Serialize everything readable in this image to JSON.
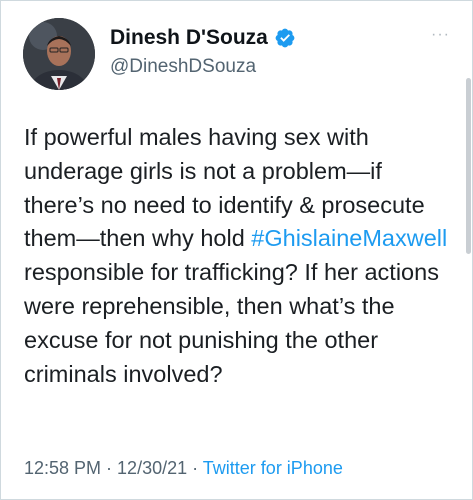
{
  "tweet": {
    "author": {
      "display_name": "Dinesh D'Souza",
      "handle": "@DineshDSouza",
      "verified": true
    },
    "text_before": "If powerful males having sex with underage girls is not a problem—if there’s no need to identify & prosecute them—then why hold ",
    "hashtag": "#GhislaineMaxwell",
    "text_after": " responsible for trafficking? If her actions were reprehensible, then what’s the excuse for not punishing the other criminals involved?",
    "time": "12:58 PM",
    "separator": " · ",
    "date": "12/30/21",
    "source": "Twitter for iPhone",
    "more_label": "···"
  },
  "colors": {
    "accent": "#1d9bf0",
    "secondary_text": "#536471",
    "primary_text": "#0f1419",
    "border": "#cfd9de"
  },
  "icons": {
    "verified": "verified-badge-icon",
    "more": "more-options-icon"
  }
}
